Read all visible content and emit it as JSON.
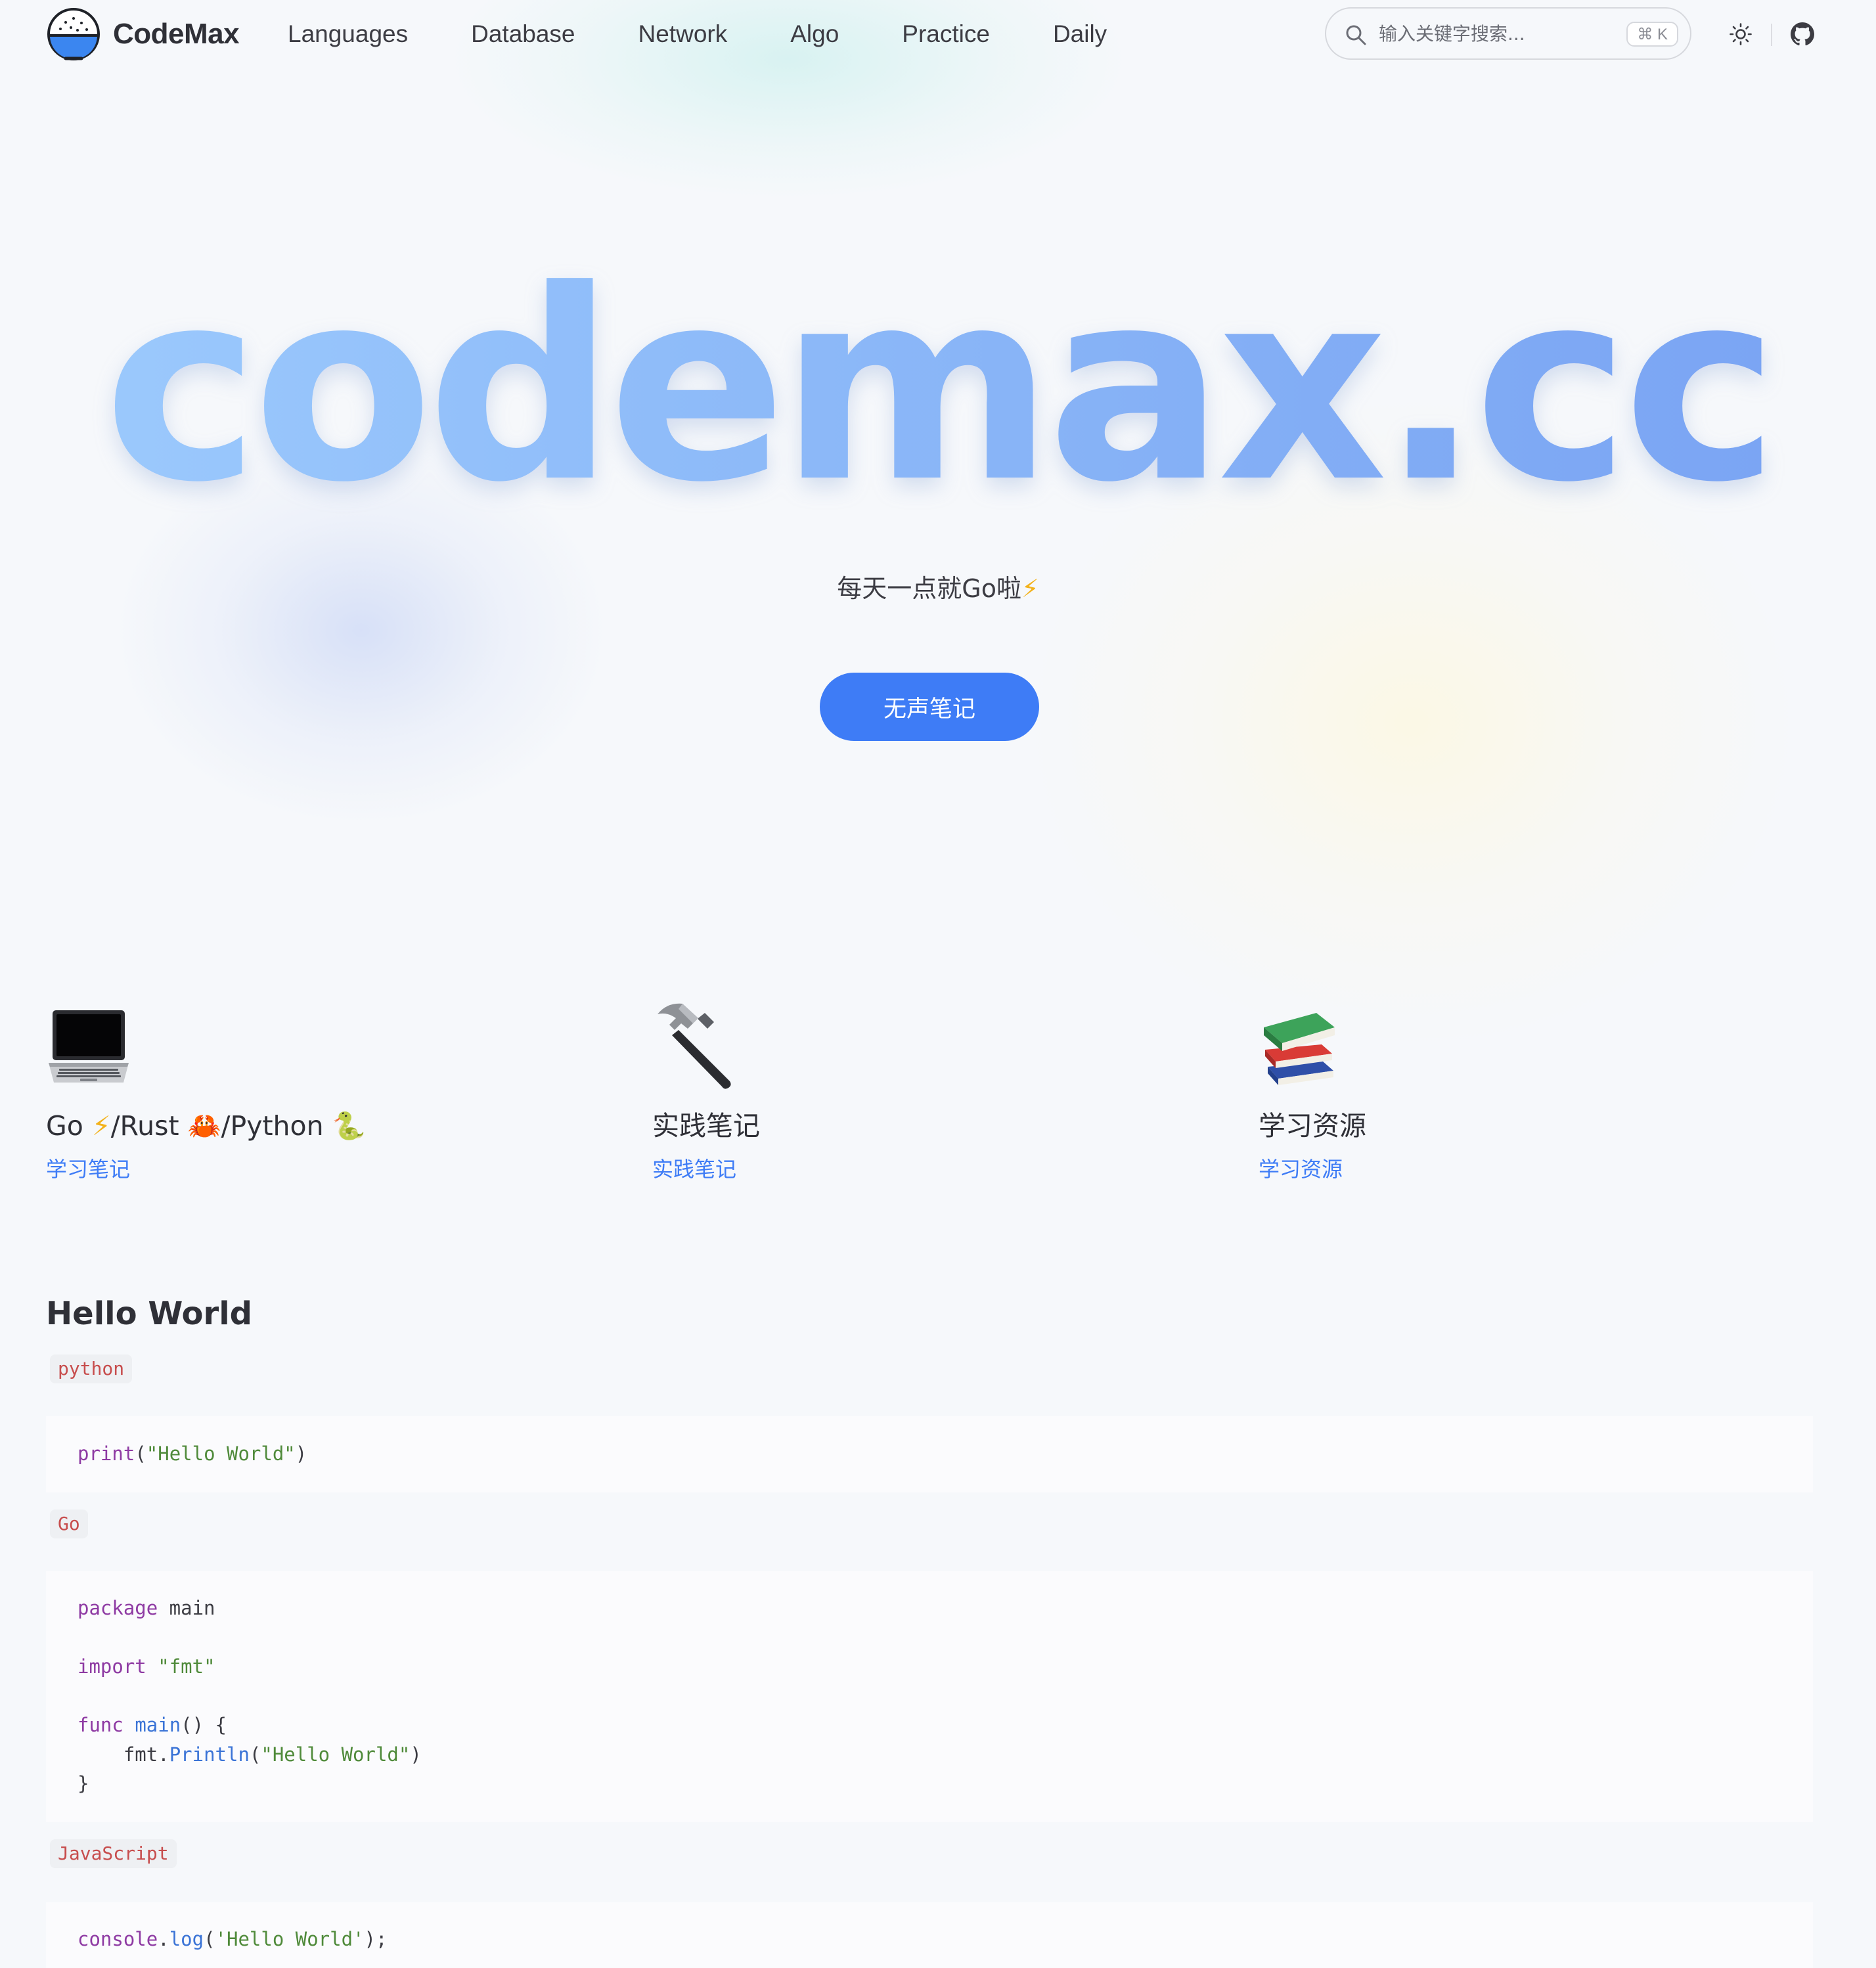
{
  "nav": {
    "brand": "CodeMax",
    "links": [
      "Languages",
      "Database",
      "Network",
      "Algo",
      "Practice",
      "Daily"
    ],
    "search": {
      "placeholder": "输入关键字搜索...",
      "shortcut": "⌘ K"
    }
  },
  "hero": {
    "title": "codemax.cc",
    "tagline": "每天一点就Go啦",
    "tagline_emoji": "⚡",
    "cta": "无声笔记"
  },
  "features": [
    {
      "icon": "laptop-icon",
      "title_parts": [
        "Go ",
        "⚡",
        "/Rust ",
        "🦀",
        "/Python ",
        "🐍"
      ],
      "link": "学习笔记"
    },
    {
      "icon": "hammer-icon",
      "title": "实践笔记",
      "link": "实践笔记"
    },
    {
      "icon": "books-icon",
      "title": "学习资源",
      "link": "学习资源"
    }
  ],
  "content": {
    "heading": "Hello World",
    "blocks": [
      {
        "lang": "python",
        "lines": [
          "print(\"Hello World\")"
        ]
      },
      {
        "lang": "Go",
        "lines": [
          "package main",
          "",
          "import \"fmt\"",
          "",
          "func main() {",
          "    fmt.Println(\"Hello World\")",
          "}"
        ]
      },
      {
        "lang": "JavaScript",
        "lines": [
          "console.log('Hello World');"
        ]
      }
    ]
  },
  "colors": {
    "accent": "#3e7cf6",
    "title_gradient_start": "#9dcbfd",
    "title_gradient_end": "#79a3f3",
    "tag_text": "#c74d4d"
  }
}
